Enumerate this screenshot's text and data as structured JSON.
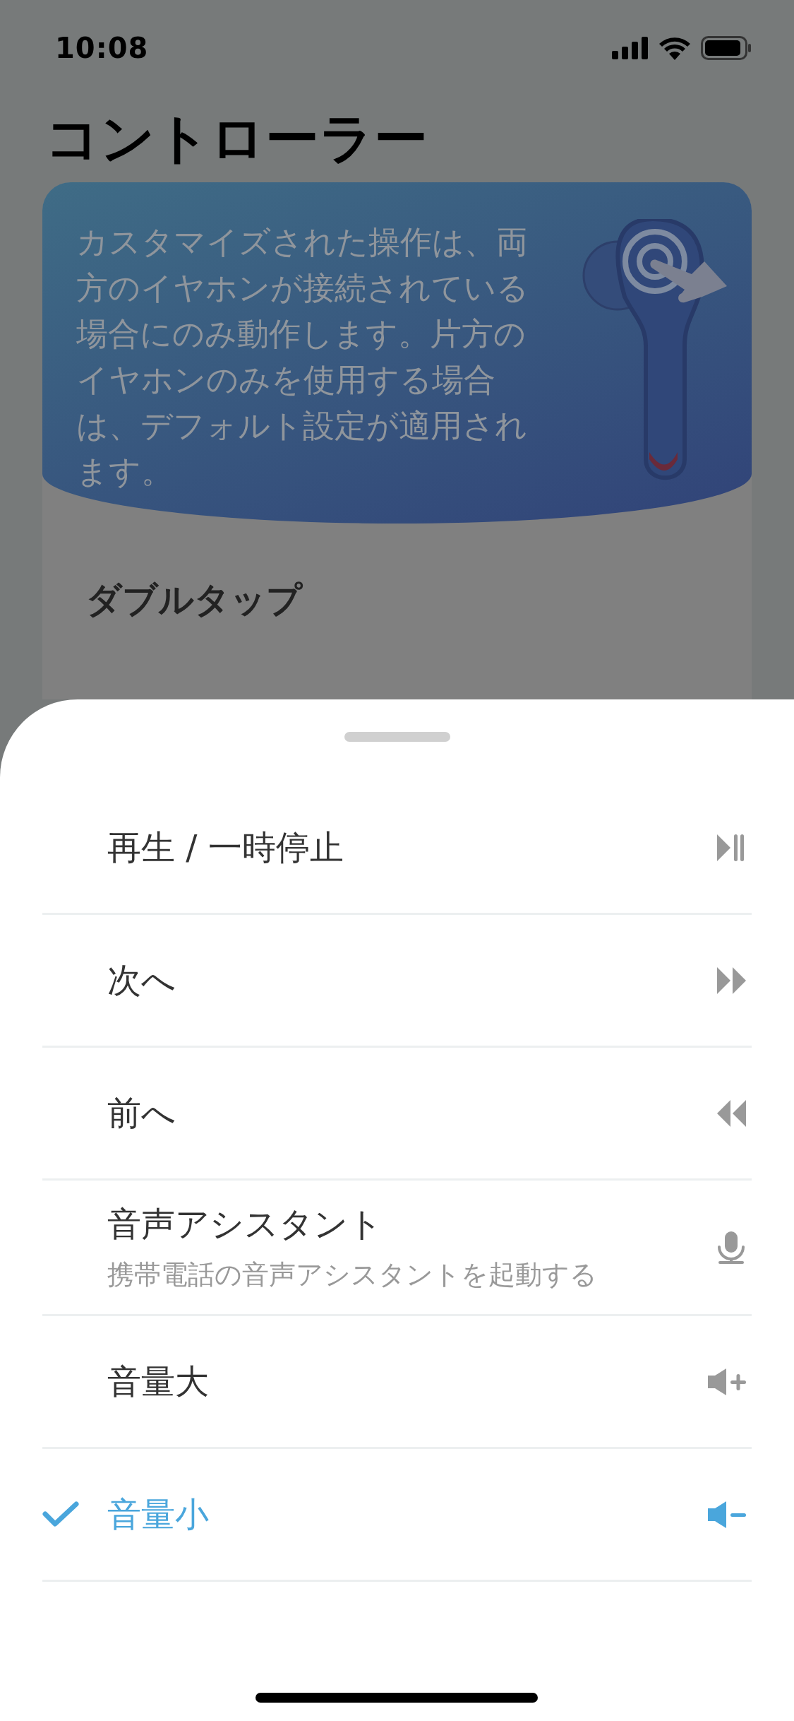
{
  "status_bar": {
    "time": "10:08"
  },
  "title": "コントローラー",
  "info_card": {
    "text": "カスタマイズされた操作は、両方のイヤホンが接続されている場合にのみ動作します。片方のイヤホンのみを使用する場合は、デフォルト設定が適用されます。"
  },
  "section_title": "ダブルタップ",
  "sheet": {
    "options": [
      {
        "label": "再生 / 一時停止",
        "kind": "play-pause",
        "selected": false
      },
      {
        "label": "次へ",
        "kind": "next",
        "selected": false
      },
      {
        "label": "前へ",
        "kind": "previous",
        "selected": false
      },
      {
        "label": "音声アシスタント",
        "description": "携帯電話の音声アシスタントを起動する",
        "kind": "mic",
        "selected": false
      },
      {
        "label": "音量大",
        "kind": "volume-up",
        "selected": false
      },
      {
        "label": "音量小",
        "kind": "volume-down",
        "selected": true
      }
    ]
  }
}
